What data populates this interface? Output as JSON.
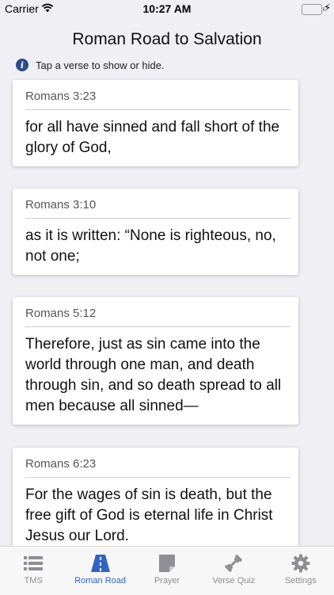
{
  "status_bar": {
    "carrier": "Carrier",
    "time": "10:27 AM",
    "battery_color": "#4cd964",
    "charging_symbol": "⚡"
  },
  "header": {
    "title": "Roman Road to Salvation"
  },
  "hint": {
    "icon": "info-icon",
    "text": "Tap a verse to show or hide."
  },
  "verses": [
    {
      "ref": "Romans 3:23",
      "text": "for all have sinned and fall short of the glory of God,"
    },
    {
      "ref": "Romans 3:10",
      "text": "as it is written: “None is righteous, no, not one;"
    },
    {
      "ref": "Romans 5:12",
      "text": "Therefore, just as sin came into the world through one man, and death through sin, and so death spread to all men because all sinned—"
    },
    {
      "ref": "Romans 6:23",
      "text": "For the wages of sin is death, but the free gift of God is eternal life in Christ Jesus our Lord."
    }
  ],
  "tab_bar": {
    "active_color": "#2f64c4",
    "inactive_color": "#8e8e93",
    "tabs": [
      {
        "label": "TMS",
        "icon": "list-icon"
      },
      {
        "label": "Roman Road",
        "icon": "road-icon",
        "active": true
      },
      {
        "label": "Prayer",
        "icon": "note-icon"
      },
      {
        "label": "Verse Quiz",
        "icon": "dumbbell-icon"
      },
      {
        "label": "Settings",
        "icon": "gear-icon"
      }
    ]
  }
}
